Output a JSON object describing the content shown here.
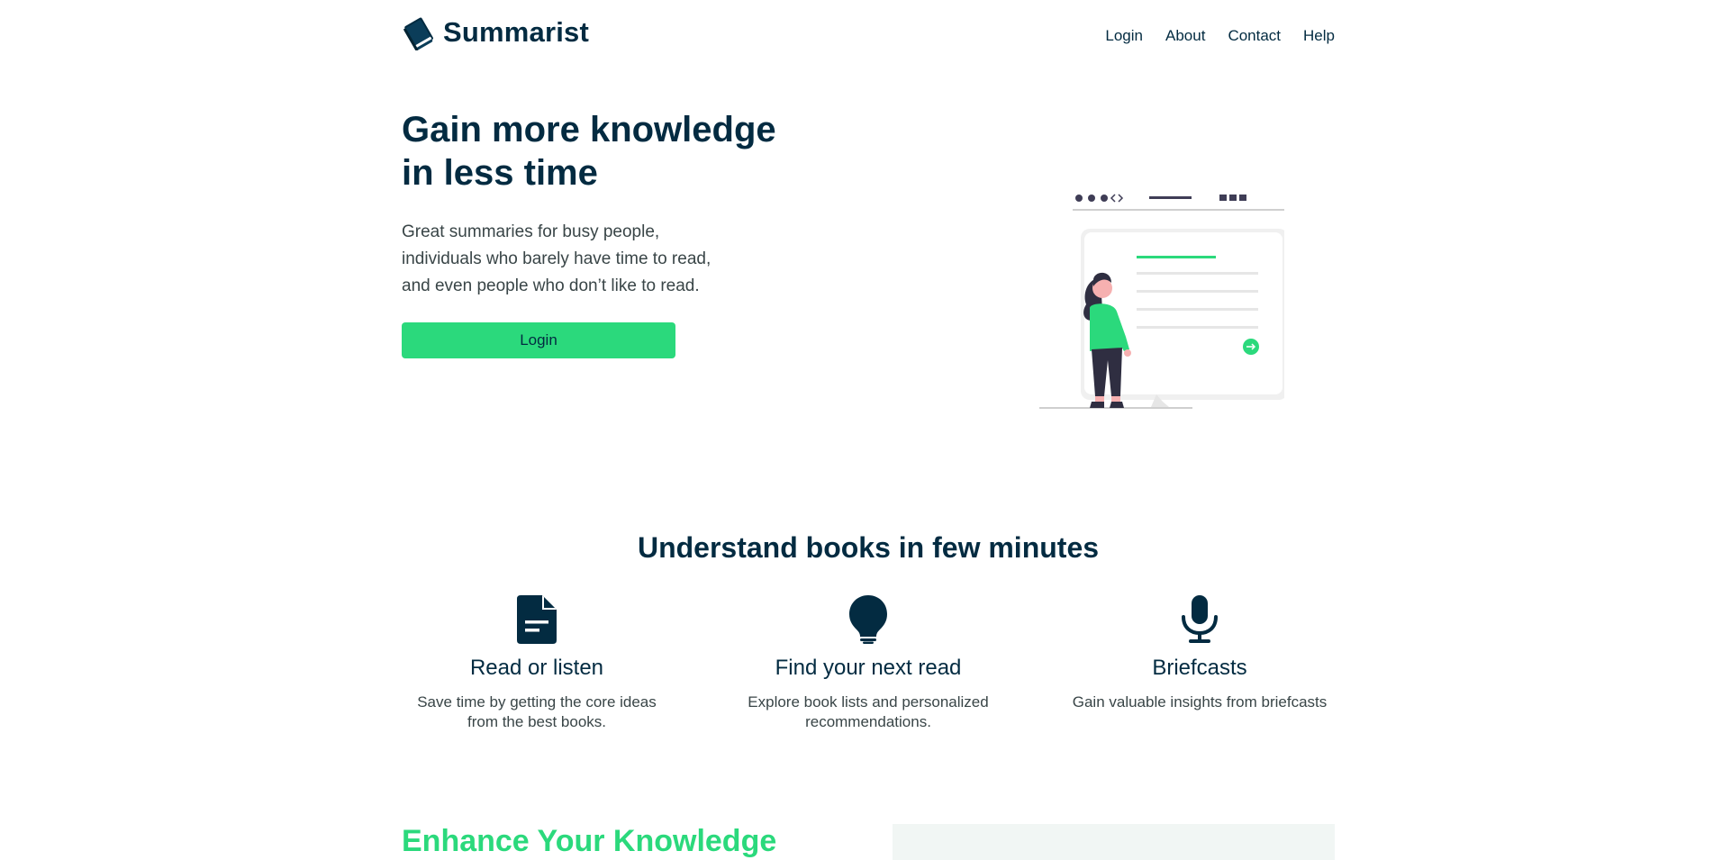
{
  "brand": {
    "name": "Summarist"
  },
  "nav": {
    "links": [
      "Login",
      "About",
      "Contact",
      "Help"
    ]
  },
  "hero": {
    "title": "Gain more knowledge in less time",
    "subtitle": "Great summaries for busy people, individuals who barely have time to read, and even people who don’t like to read.",
    "button_label": "Login"
  },
  "features": {
    "title": "Understand books in few minutes",
    "items": [
      {
        "icon": "document-icon",
        "title": "Read or listen",
        "description": "Save time by getting the core ideas from the best books."
      },
      {
        "icon": "lightbulb-icon",
        "title": "Find your next read",
        "description": "Explore book lists and personalized recommendations."
      },
      {
        "icon": "microphone-icon",
        "title": "Briefcasts",
        "description": "Gain valuable insights from briefcasts"
      }
    ]
  },
  "enhance": {
    "title": "Enhance Your Knowledge"
  },
  "colors": {
    "primary": "#032b41",
    "accent": "#2bd97c",
    "text_muted": "#394547"
  }
}
